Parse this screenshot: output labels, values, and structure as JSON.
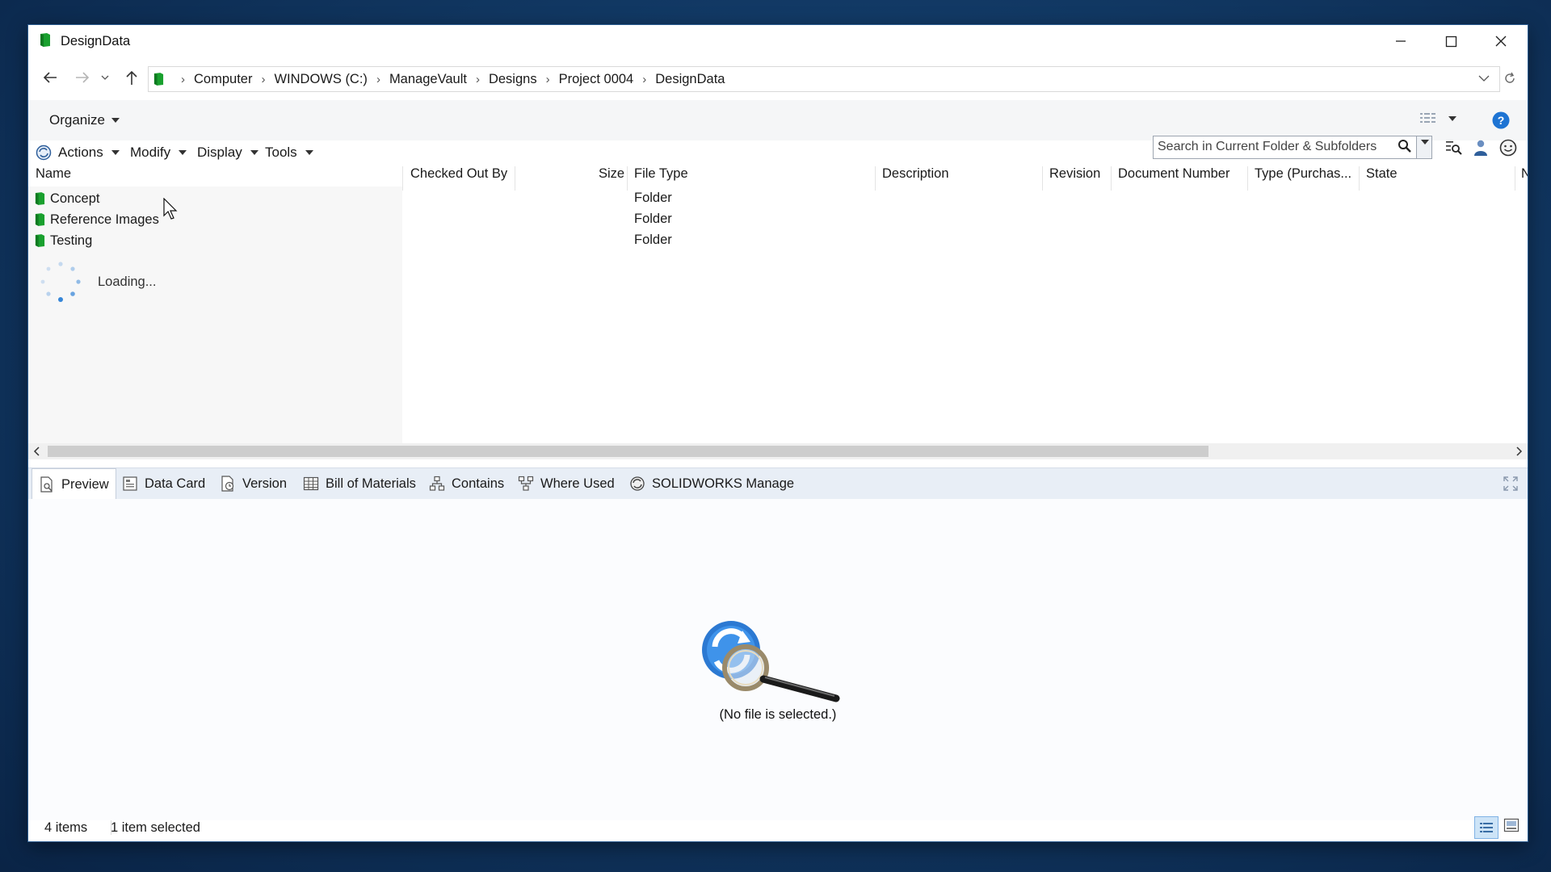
{
  "window": {
    "title": "DesignData",
    "controls": {
      "minimize": "minimize-icon",
      "maximize": "maximize-icon",
      "close": "close-icon"
    }
  },
  "address": {
    "breadcrumb": [
      "Computer",
      "WINDOWS (C:)",
      "ManageVault",
      "Designs",
      "Project 0004",
      "DesignData"
    ]
  },
  "command_bar": {
    "organize": "Organize"
  },
  "vault_menu": {
    "items": [
      "Actions",
      "Modify",
      "Display",
      "Tools"
    ],
    "search_placeholder": "Search in Current Folder & Subfolders"
  },
  "columns": [
    "Name",
    "Checked Out By",
    "Size",
    "File Type",
    "Description",
    "Revision",
    "Document Number",
    "Type (Purchas...",
    "State",
    "N"
  ],
  "files": [
    {
      "name": "Concept",
      "file_type": "Folder"
    },
    {
      "name": "Reference Images",
      "file_type": "Folder"
    },
    {
      "name": "Testing",
      "file_type": "Folder"
    }
  ],
  "loading_text": "Loading...",
  "tabs": [
    "Preview",
    "Data Card",
    "Version",
    "Bill of Materials",
    "Contains",
    "Where Used",
    "SOLIDWORKS Manage"
  ],
  "preview": {
    "empty_text": "(No file is selected.)"
  },
  "status": {
    "items_count": "4 items",
    "selection": "1 item selected"
  },
  "colors": {
    "accent": "#1e74d3",
    "vault_green": "#1aa531",
    "desktop": "#123a66"
  }
}
